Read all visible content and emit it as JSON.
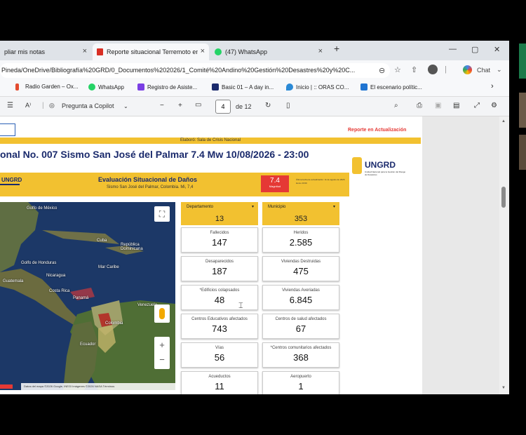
{
  "tabs": [
    {
      "label": "pliar mis notas",
      "close": "×"
    },
    {
      "label": "Reporte situacional Terremoto en",
      "close": "×"
    },
    {
      "label": "(47) WhatsApp",
      "close": "×"
    }
  ],
  "new_tab": "+",
  "window_controls": {
    "minimize": "—",
    "maximize": "▢",
    "close": "✕"
  },
  "url": "Pineda/OneDrive/Bibliografía%20GRD/0_Documentos%202026/1_Comité%20Andino%20Gestión%20Desastres%20y%20C...",
  "addr_icons": [
    "zoom-icon",
    "star-icon",
    "extension-icon",
    "profile-icon"
  ],
  "chat_label": "Chat",
  "favorites": [
    {
      "label": "Radio Garden – Ox...",
      "color": "#e34b2f"
    },
    {
      "label": "WhatsApp",
      "color": "#25d366"
    },
    {
      "label": "Registro de Asiste...",
      "color": "#7b3fe4"
    },
    {
      "label": "Basic 01 – A day in...",
      "color": "#1a2a6c"
    },
    {
      "label": "Inicio | :: ORAS CO...",
      "color": "#2b8ad6"
    },
    {
      "label": "El escenario polític...",
      "color": "#1f74d1"
    }
  ],
  "pdf_toolbar": {
    "read_aloud": "A⁾",
    "copilot": "Pregunta a Copilot",
    "zoom_out": "−",
    "zoom_in": "+",
    "page_current": "4",
    "page_total": "de 12"
  },
  "report": {
    "elaboro": "Elaboró: Sala de Crisis Nacional",
    "status": "Reporte en Actualización",
    "title": "onal No. 007 Sismo San José del Palmar 7.4 Mw 10/08/2026 - 23:00",
    "logo_text": "UNGRD",
    "logo_sub": "Unidad Nacional para la Gestión del Riesgo de Desastres",
    "banner_logo": "UNGRD",
    "banner_title": "Evaluación Situacional de Daños",
    "banner_subtitle": "Sismo San José del Palmar, Colombia. Mi, 7,4",
    "magnitude": "7.4",
    "magnitude_label": "Magnitud",
    "update_note": "Última fecha de actualización: 11 de agosto de 2026 Hora: 23:00",
    "colors": {
      "yellow": "#f2c130",
      "red": "#e53935",
      "blue": "#1a2a6c"
    }
  },
  "map": {
    "labels": [
      "Golfo de México",
      "Cuba",
      "Golfo de Honduras",
      "República Dominicana",
      "Guatemala",
      "Nicaragua",
      "Mar Caribe",
      "Costa Rica",
      "Panamá",
      "Venezuela",
      "Colombia",
      "Ecuador"
    ],
    "attribution": "Datos del mapa ©2026 Google, INEGI  Imágenes ©2026 NASA  Términos"
  },
  "filters": [
    {
      "label": "Departamento",
      "value": "13"
    },
    {
      "label": "Municipio",
      "value": "353"
    }
  ],
  "stats": [
    {
      "label": "Fallecidos",
      "value": "147"
    },
    {
      "label": "Heridos",
      "value": "2.585"
    },
    {
      "label": "Desaparecidos",
      "value": "187"
    },
    {
      "label": "Viviendas Destruidas",
      "value": "475"
    },
    {
      "label": "*Edificios colapsados",
      "value": "48"
    },
    {
      "label": "Viviendas Averiadas",
      "value": "6.845"
    },
    {
      "label": "Centros Educativos afectados",
      "value": "743"
    },
    {
      "label": "Centros de salud afectados",
      "value": "67"
    },
    {
      "label": "Vías",
      "value": "56"
    },
    {
      "label": "*Centros comunitarios afectados",
      "value": "368"
    },
    {
      "label": "Acueductos",
      "value": "11"
    },
    {
      "label": "Aeropuerto",
      "value": "1"
    }
  ]
}
